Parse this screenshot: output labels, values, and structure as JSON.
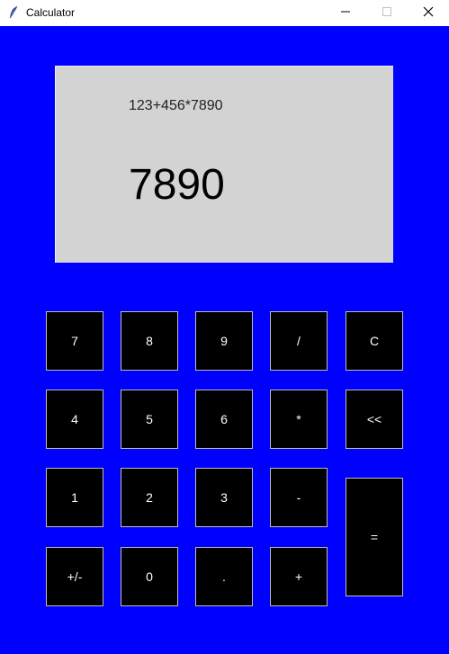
{
  "window": {
    "title": "Calculator",
    "icon": "feather-icon"
  },
  "display": {
    "expression": "123+456*7890",
    "result": "7890"
  },
  "keys": {
    "seven": "7",
    "eight": "8",
    "nine": "9",
    "divide": "/",
    "clear": "C",
    "four": "4",
    "five": "5",
    "six": "6",
    "multiply": "*",
    "backspace": "<<",
    "one": "1",
    "two": "2",
    "three": "3",
    "subtract": "-",
    "equals": "=",
    "negate": "+/-",
    "zero": "0",
    "decimal": ".",
    "add": "+"
  },
  "colors": {
    "background": "#0000ff",
    "display": "#d3d3d3",
    "key": "#000000",
    "key_text": "#ffffff"
  }
}
